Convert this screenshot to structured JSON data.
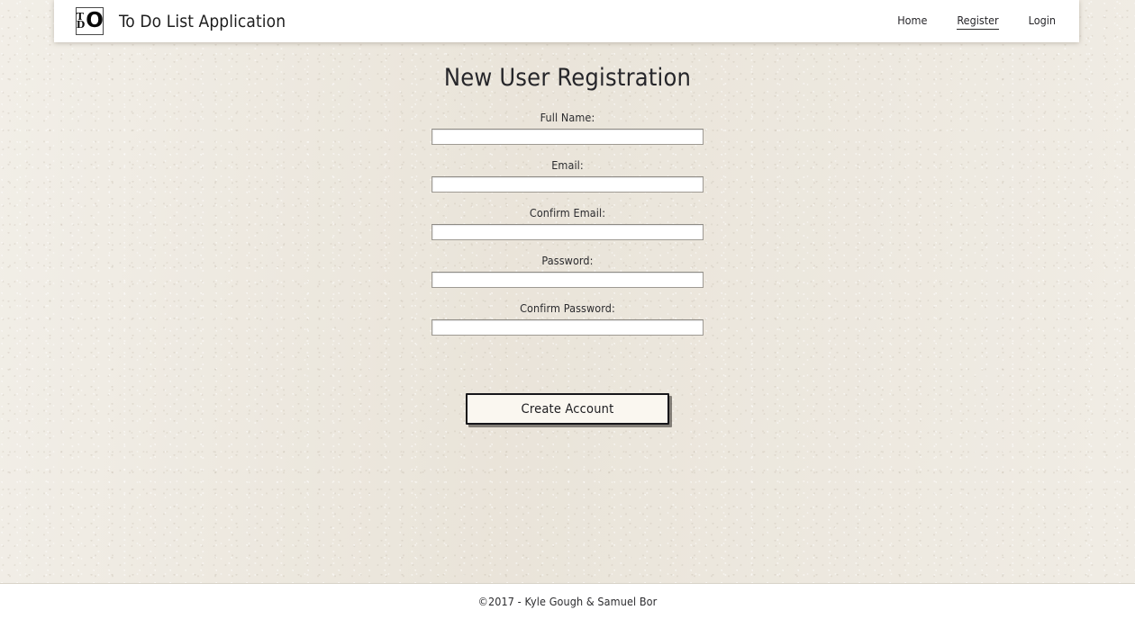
{
  "header": {
    "logo": {
      "icon": "tdo-monogram-logo-icon",
      "line_top": "T",
      "line_bottom": "D",
      "letter_o": "O"
    },
    "brand_title": "To Do List Application",
    "nav": [
      {
        "label": "Home",
        "active": false
      },
      {
        "label": "Register",
        "active": true
      },
      {
        "label": "Login",
        "active": false
      }
    ]
  },
  "main": {
    "page_title": "New User Registration",
    "fields": [
      {
        "label": "Full Name:",
        "value": "",
        "placeholder": "",
        "type": "text"
      },
      {
        "label": "Email:",
        "value": "",
        "placeholder": "",
        "type": "text"
      },
      {
        "label": "Confirm Email:",
        "value": "",
        "placeholder": "",
        "type": "text"
      },
      {
        "label": "Password:",
        "value": "",
        "placeholder": "",
        "type": "password"
      },
      {
        "label": "Confirm Password:",
        "value": "",
        "placeholder": "",
        "type": "password"
      }
    ],
    "submit_label": "Create Account"
  },
  "footer": {
    "copyright": "©2017 - Kyle Gough & Samuel Bor"
  },
  "colors": {
    "page_background": "#ece7dd",
    "surface": "#ffffff",
    "text": "#26262a",
    "button_face": "#faf7f0",
    "button_border": "#16161a",
    "input_border": "#9e9a93"
  }
}
